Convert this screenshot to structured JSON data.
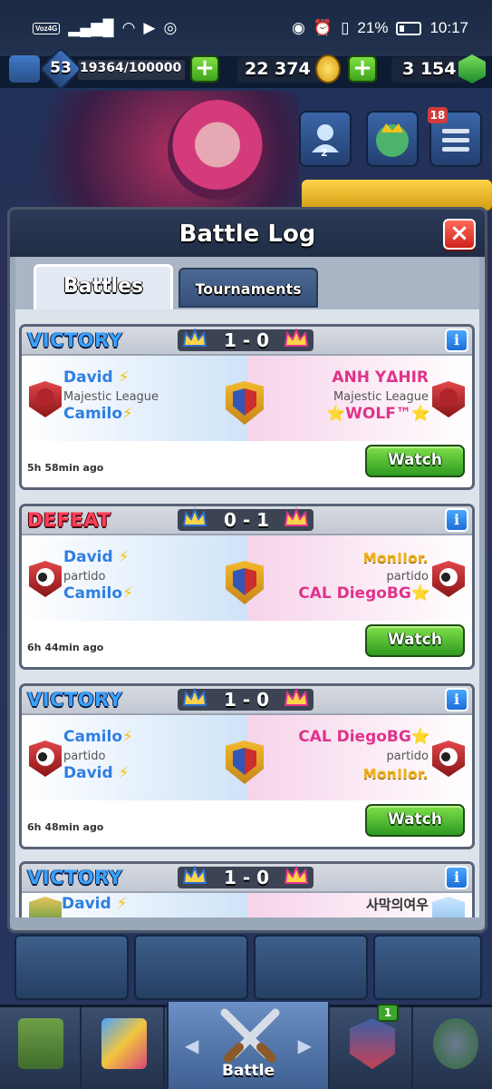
{
  "status_bar": {
    "volte": "Voz4G",
    "battery": "21%",
    "time": "10:17"
  },
  "header": {
    "level": "53",
    "xp": "19364/100000",
    "gold": "22 374",
    "gems": "3 154",
    "plus_label": "+"
  },
  "side_buttons": {
    "friends_count": "2",
    "menu_badge": "18"
  },
  "panel": {
    "title": "Battle Log",
    "close_label": "×",
    "tabs": [
      {
        "label": "Battles",
        "active": true
      },
      {
        "label": "Tournaments",
        "active": false
      }
    ]
  },
  "battles": [
    {
      "result": "VICTORY",
      "score": "1 - 0",
      "left": {
        "p1": "David",
        "league": "Majestic League",
        "p2": "Camilo"
      },
      "right": {
        "p1": "ANH YΔHIR",
        "league": "Majestic League",
        "p2": "⭐WOLF™⭐"
      },
      "ago": "5h 58min ago",
      "watch": "Watch",
      "info": "i"
    },
    {
      "result": "DEFEAT",
      "score": "0 - 1",
      "left": {
        "p1": "David",
        "league": "partido",
        "p2": "Camilo"
      },
      "right": {
        "p1": "MonIIor.",
        "league": "partido",
        "p2": "CAL DiegoBG⭐"
      },
      "ago": "6h 44min ago",
      "watch": "Watch",
      "info": "i"
    },
    {
      "result": "VICTORY",
      "score": "1 - 0",
      "left": {
        "p1": "Camilo",
        "league": "partido",
        "p2": "David"
      },
      "right": {
        "p1": "CAL DiegoBG⭐",
        "league": "partido",
        "p2": "MonIIor."
      },
      "ago": "6h 48min ago",
      "watch": "Watch",
      "info": "i"
    },
    {
      "result": "VICTORY",
      "score": "1 - 0",
      "left": {
        "p1": "David"
      },
      "right": {
        "p1": "사막의여우"
      },
      "info": "i"
    }
  ],
  "bottom_nav": {
    "battle_label": "Battle",
    "clan_badge": "1"
  },
  "colors": {
    "victory": "#3aa2ff",
    "defeat": "#ff3e57",
    "watch_button": "#3ea31c",
    "close_button": "#d0231b"
  }
}
